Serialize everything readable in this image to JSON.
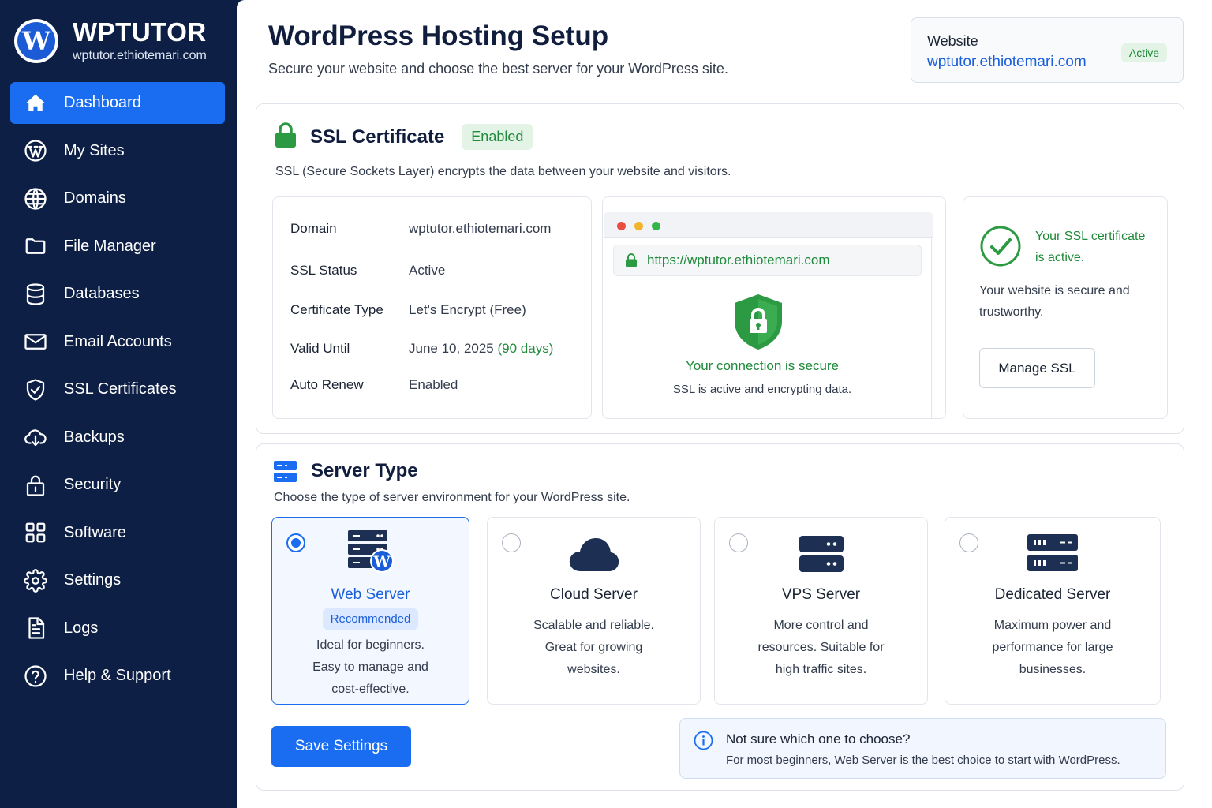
{
  "brand": {
    "name": "WPTUTOR",
    "domain": "wptutor.ethiotemari.com",
    "logo_letter": "W"
  },
  "sidebar": {
    "items": [
      {
        "label": "Dashboard",
        "icon": "home-icon",
        "active": true
      },
      {
        "label": "My Sites",
        "icon": "wordpress-icon"
      },
      {
        "label": "Domains",
        "icon": "globe-icon"
      },
      {
        "label": "File Manager",
        "icon": "folder-icon"
      },
      {
        "label": "Databases",
        "icon": "database-icon"
      },
      {
        "label": "Email Accounts",
        "icon": "mail-icon"
      },
      {
        "label": "SSL Certificates",
        "icon": "shield-check-icon"
      },
      {
        "label": "Backups",
        "icon": "cloud-download-icon"
      },
      {
        "label": "Security",
        "icon": "lock-icon"
      },
      {
        "label": "Software",
        "icon": "grid-icon"
      },
      {
        "label": "Settings",
        "icon": "gear-icon"
      },
      {
        "label": "Logs",
        "icon": "document-icon"
      },
      {
        "label": "Help & Support",
        "icon": "help-icon"
      }
    ]
  },
  "header": {
    "title": "WordPress Hosting Setup",
    "subtitle": "Secure your website and choose the best server for your WordPress site."
  },
  "website_card": {
    "label": "Website",
    "url": "wptutor.ethiotemari.com",
    "status": "Active"
  },
  "ssl": {
    "title": "SSL Certificate",
    "badge": "Enabled",
    "description": "SSL (Secure Sockets Layer) encrypts the data between your website and visitors.",
    "details": {
      "domain_label": "Domain",
      "domain_value": "wptutor.ethiotemari.com",
      "status_label": "SSL Status",
      "status_value": "Active",
      "type_label": "Certificate Type",
      "type_value": "Let's Encrypt (Free)",
      "valid_label": "Valid Until",
      "valid_value": "June 10, 2025",
      "valid_days": "(90 days)",
      "renew_label": "Auto Renew",
      "renew_value": "Enabled"
    },
    "browser": {
      "url": "https://wptutor.ethiotemari.com",
      "secure_title": "Your connection is secure",
      "secure_sub": "SSL is active and encrypting data."
    },
    "status": {
      "active_text": "Your SSL certificate is active.",
      "secure_text": "Your website is secure and trustworthy.",
      "manage_button": "Manage SSL"
    }
  },
  "server": {
    "title": "Server Type",
    "description": "Choose the type of server environment for your WordPress site.",
    "options": [
      {
        "name": "Web Server",
        "badge": "Recommended",
        "desc_lines": [
          "Ideal for beginners.",
          "Easy to manage and",
          "cost-effective."
        ],
        "selected": true
      },
      {
        "name": "Cloud Server",
        "desc_lines": [
          "Scalable and reliable.",
          "Great for growing",
          "websites."
        ],
        "selected": false
      },
      {
        "name": "VPS Server",
        "desc_lines": [
          "More control and",
          "resources. Suitable for",
          "high traffic sites."
        ],
        "selected": false
      },
      {
        "name": "Dedicated Server",
        "desc_lines": [
          "Maximum power and",
          "performance for large",
          "businesses."
        ],
        "selected": false
      }
    ],
    "save_button": "Save Settings",
    "hint": {
      "title": "Not sure which one to choose?",
      "text": "For most beginners, Web Server is the best choice to start with WordPress."
    }
  },
  "colors": {
    "sidebar_bg": "#0d1f45",
    "accent": "#1a6cf0",
    "success": "#1f8a3a",
    "link": "#1a5fd9"
  }
}
